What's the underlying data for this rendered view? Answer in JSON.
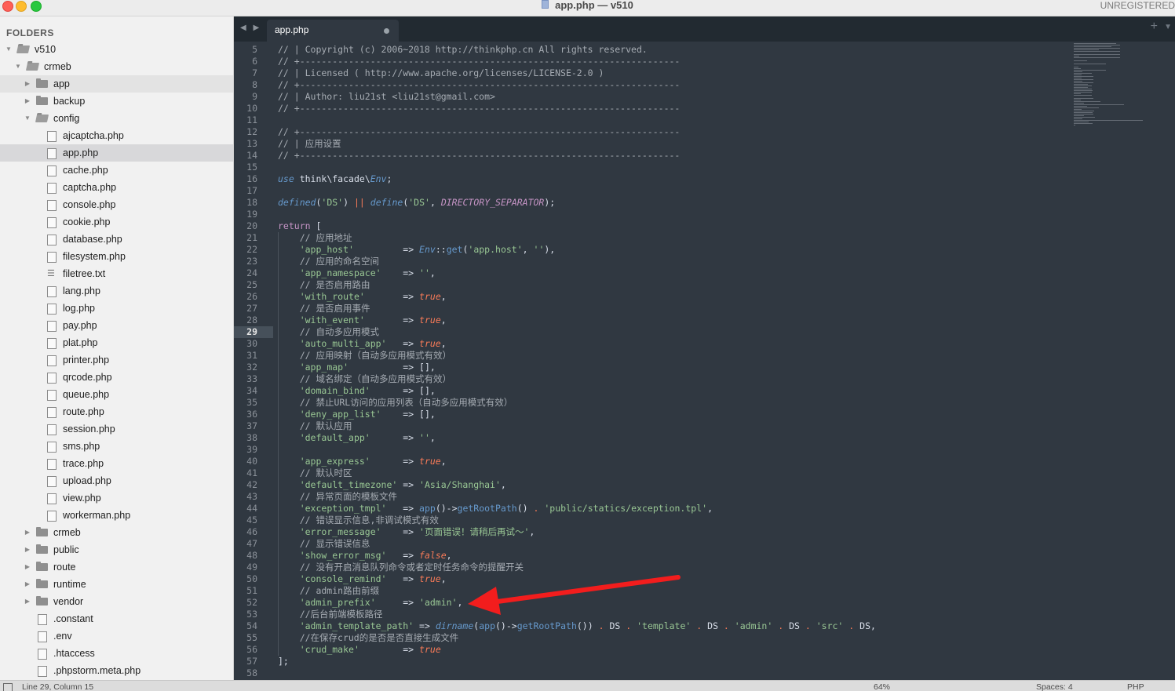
{
  "window": {
    "title": "app.php — v510",
    "license": "UNREGISTERED"
  },
  "sidebar": {
    "header": "FOLDERS",
    "items": [
      {
        "label": "v510",
        "kind": "folder",
        "open": true,
        "depth": 0
      },
      {
        "label": "crmeb",
        "kind": "folder",
        "open": true,
        "depth": 1
      },
      {
        "label": "app",
        "kind": "folder",
        "open": false,
        "depth": 2
      },
      {
        "label": "backup",
        "kind": "folder",
        "open": false,
        "depth": 2
      },
      {
        "label": "config",
        "kind": "folder",
        "open": true,
        "depth": 2
      },
      {
        "label": "ajcaptcha.php",
        "kind": "file",
        "depth": 3
      },
      {
        "label": "app.php",
        "kind": "file",
        "depth": 3,
        "selected": true
      },
      {
        "label": "cache.php",
        "kind": "file",
        "depth": 3
      },
      {
        "label": "captcha.php",
        "kind": "file",
        "depth": 3
      },
      {
        "label": "console.php",
        "kind": "file",
        "depth": 3
      },
      {
        "label": "cookie.php",
        "kind": "file",
        "depth": 3
      },
      {
        "label": "database.php",
        "kind": "file",
        "depth": 3
      },
      {
        "label": "filesystem.php",
        "kind": "file",
        "depth": 3
      },
      {
        "label": "filetree.txt",
        "kind": "txt",
        "depth": 3
      },
      {
        "label": "lang.php",
        "kind": "file",
        "depth": 3
      },
      {
        "label": "log.php",
        "kind": "file",
        "depth": 3
      },
      {
        "label": "pay.php",
        "kind": "file",
        "depth": 3
      },
      {
        "label": "plat.php",
        "kind": "file",
        "depth": 3
      },
      {
        "label": "printer.php",
        "kind": "file",
        "depth": 3
      },
      {
        "label": "qrcode.php",
        "kind": "file",
        "depth": 3
      },
      {
        "label": "queue.php",
        "kind": "file",
        "depth": 3
      },
      {
        "label": "route.php",
        "kind": "file",
        "depth": 3
      },
      {
        "label": "session.php",
        "kind": "file",
        "depth": 3
      },
      {
        "label": "sms.php",
        "kind": "file",
        "depth": 3
      },
      {
        "label": "trace.php",
        "kind": "file",
        "depth": 3
      },
      {
        "label": "upload.php",
        "kind": "file",
        "depth": 3
      },
      {
        "label": "view.php",
        "kind": "file",
        "depth": 3
      },
      {
        "label": "workerman.php",
        "kind": "file",
        "depth": 3
      },
      {
        "label": "crmeb",
        "kind": "folder",
        "open": false,
        "depth": 2
      },
      {
        "label": "public",
        "kind": "folder",
        "open": false,
        "depth": 2
      },
      {
        "label": "route",
        "kind": "folder",
        "open": false,
        "depth": 2
      },
      {
        "label": "runtime",
        "kind": "folder",
        "open": false,
        "depth": 2
      },
      {
        "label": "vendor",
        "kind": "folder",
        "open": false,
        "depth": 2
      },
      {
        "label": ".constant",
        "kind": "file",
        "depth": 2
      },
      {
        "label": ".env",
        "kind": "file",
        "depth": 2
      },
      {
        "label": ".htaccess",
        "kind": "file",
        "depth": 2
      },
      {
        "label": ".phpstorm.meta.php",
        "kind": "file",
        "depth": 2
      }
    ]
  },
  "tabs": {
    "nav": "◀ ▶",
    "active_label": "app.php",
    "new_tab": "+",
    "menu": "▼"
  },
  "editor": {
    "current_line": 29,
    "lines": [
      {
        "n": "5",
        "t": [
          [
            "c-com",
            "// | Copyright (c) 2006~2018 http://thinkphp.cn All rights reserved."
          ]
        ]
      },
      {
        "n": "6",
        "t": [
          [
            "c-com",
            "// +----------------------------------------------------------------------"
          ]
        ]
      },
      {
        "n": "7",
        "t": [
          [
            "c-com",
            "// | Licensed ( http://www.apache.org/licenses/LICENSE-2.0 )"
          ]
        ]
      },
      {
        "n": "8",
        "t": [
          [
            "c-com",
            "// +----------------------------------------------------------------------"
          ]
        ]
      },
      {
        "n": "9",
        "t": [
          [
            "c-com",
            "// | Author: liu21st <liu21st@gmail.com>"
          ]
        ]
      },
      {
        "n": "10",
        "t": [
          [
            "c-com",
            "// +----------------------------------------------------------------------"
          ]
        ]
      },
      {
        "n": "11",
        "t": []
      },
      {
        "n": "12",
        "t": [
          [
            "c-com",
            "// +----------------------------------------------------------------------"
          ]
        ]
      },
      {
        "n": "13",
        "t": [
          [
            "c-com",
            "// | 应用设置"
          ]
        ]
      },
      {
        "n": "14",
        "t": [
          [
            "c-com",
            "// +----------------------------------------------------------------------"
          ]
        ]
      },
      {
        "n": "15",
        "t": []
      },
      {
        "n": "16",
        "t": [
          [
            "c-fn",
            "use"
          ],
          [
            "c-plain",
            " think\\facade\\"
          ],
          [
            "c-fn",
            "Env"
          ],
          [
            "c-plain",
            ";"
          ]
        ]
      },
      {
        "n": "17",
        "t": []
      },
      {
        "n": "18",
        "t": [
          [
            "c-fn",
            "defined"
          ],
          [
            "c-plain",
            "("
          ],
          [
            "c-str",
            "'DS'"
          ],
          [
            "c-plain",
            ") "
          ],
          [
            "c-op",
            "||"
          ],
          [
            "c-plain",
            " "
          ],
          [
            "c-fn",
            "define"
          ],
          [
            "c-plain",
            "("
          ],
          [
            "c-str",
            "'DS'"
          ],
          [
            "c-plain",
            ", "
          ],
          [
            "c-const",
            "DIRECTORY_SEPARATOR"
          ],
          [
            "c-plain",
            ");"
          ]
        ]
      },
      {
        "n": "19",
        "t": []
      },
      {
        "n": "20",
        "t": [
          [
            "c-kw",
            "return"
          ],
          [
            "c-plain",
            " ["
          ]
        ]
      },
      {
        "n": "21",
        "t": [
          [
            "c-com",
            "    // 应用地址"
          ]
        ]
      },
      {
        "n": "22",
        "t": [
          [
            "c-plain",
            "    "
          ],
          [
            "c-str",
            "'app_host'"
          ],
          [
            "c-plain",
            "         => "
          ],
          [
            "c-fn",
            "Env"
          ],
          [
            "c-plain",
            "::"
          ],
          [
            "c-fn2",
            "get"
          ],
          [
            "c-plain",
            "("
          ],
          [
            "c-str",
            "'app.host'"
          ],
          [
            "c-plain",
            ", "
          ],
          [
            "c-str",
            "''"
          ],
          [
            "c-plain",
            "),"
          ]
        ]
      },
      {
        "n": "23",
        "t": [
          [
            "c-com",
            "    // 应用的命名空间"
          ]
        ]
      },
      {
        "n": "24",
        "t": [
          [
            "c-plain",
            "    "
          ],
          [
            "c-str",
            "'app_namespace'"
          ],
          [
            "c-plain",
            "    => "
          ],
          [
            "c-str",
            "''"
          ],
          [
            "c-plain",
            ","
          ]
        ]
      },
      {
        "n": "25",
        "t": [
          [
            "c-com",
            "    // 是否启用路由"
          ]
        ]
      },
      {
        "n": "26",
        "t": [
          [
            "c-plain",
            "    "
          ],
          [
            "c-str",
            "'with_route'"
          ],
          [
            "c-plain",
            "       => "
          ],
          [
            "c-bool",
            "true"
          ],
          [
            "c-plain",
            ","
          ]
        ]
      },
      {
        "n": "27",
        "t": [
          [
            "c-com",
            "    // 是否启用事件"
          ]
        ]
      },
      {
        "n": "28",
        "t": [
          [
            "c-plain",
            "    "
          ],
          [
            "c-str",
            "'with_event'"
          ],
          [
            "c-plain",
            "       => "
          ],
          [
            "c-bool",
            "true"
          ],
          [
            "c-plain",
            ","
          ]
        ]
      },
      {
        "n": "29",
        "t": [
          [
            "c-com",
            "    // 自动多应用模式"
          ]
        ]
      },
      {
        "n": "30",
        "t": [
          [
            "c-plain",
            "    "
          ],
          [
            "c-str",
            "'auto_multi_app'"
          ],
          [
            "c-plain",
            "   => "
          ],
          [
            "c-bool",
            "true"
          ],
          [
            "c-plain",
            ","
          ]
        ]
      },
      {
        "n": "31",
        "t": [
          [
            "c-com",
            "    // 应用映射（自动多应用模式有效）"
          ]
        ]
      },
      {
        "n": "32",
        "t": [
          [
            "c-plain",
            "    "
          ],
          [
            "c-str",
            "'app_map'"
          ],
          [
            "c-plain",
            "          => [],"
          ]
        ]
      },
      {
        "n": "33",
        "t": [
          [
            "c-com",
            "    // 域名绑定（自动多应用模式有效）"
          ]
        ]
      },
      {
        "n": "34",
        "t": [
          [
            "c-plain",
            "    "
          ],
          [
            "c-str",
            "'domain_bind'"
          ],
          [
            "c-plain",
            "      => [],"
          ]
        ]
      },
      {
        "n": "35",
        "t": [
          [
            "c-com",
            "    // 禁止URL访问的应用列表（自动多应用模式有效）"
          ]
        ]
      },
      {
        "n": "36",
        "t": [
          [
            "c-plain",
            "    "
          ],
          [
            "c-str",
            "'deny_app_list'"
          ],
          [
            "c-plain",
            "    => [],"
          ]
        ]
      },
      {
        "n": "37",
        "t": [
          [
            "c-com",
            "    // 默认应用"
          ]
        ]
      },
      {
        "n": "38",
        "t": [
          [
            "c-plain",
            "    "
          ],
          [
            "c-str",
            "'default_app'"
          ],
          [
            "c-plain",
            "      => "
          ],
          [
            "c-str",
            "''"
          ],
          [
            "c-plain",
            ","
          ]
        ]
      },
      {
        "n": "39",
        "t": []
      },
      {
        "n": "40",
        "t": [
          [
            "c-plain",
            "    "
          ],
          [
            "c-str",
            "'app_express'"
          ],
          [
            "c-plain",
            "      => "
          ],
          [
            "c-bool",
            "true"
          ],
          [
            "c-plain",
            ","
          ]
        ]
      },
      {
        "n": "41",
        "t": [
          [
            "c-com",
            "    // 默认时区"
          ]
        ]
      },
      {
        "n": "42",
        "t": [
          [
            "c-plain",
            "    "
          ],
          [
            "c-str",
            "'default_timezone'"
          ],
          [
            "c-plain",
            " => "
          ],
          [
            "c-str",
            "'Asia/Shanghai'"
          ],
          [
            "c-plain",
            ","
          ]
        ]
      },
      {
        "n": "43",
        "t": [
          [
            "c-com",
            "    // 异常页面的模板文件"
          ]
        ]
      },
      {
        "n": "44",
        "t": [
          [
            "c-plain",
            "    "
          ],
          [
            "c-str",
            "'exception_tmpl'"
          ],
          [
            "c-plain",
            "   => "
          ],
          [
            "c-fn2",
            "app"
          ],
          [
            "c-plain",
            "()->"
          ],
          [
            "c-fn2",
            "getRootPath"
          ],
          [
            "c-plain",
            "() "
          ],
          [
            "c-op",
            "."
          ],
          [
            "c-plain",
            " "
          ],
          [
            "c-str",
            "'public/statics/exception.tpl'"
          ],
          [
            "c-plain",
            ","
          ]
        ]
      },
      {
        "n": "45",
        "t": [
          [
            "c-com",
            "    // 错误显示信息,非调试模式有效"
          ]
        ]
      },
      {
        "n": "46",
        "t": [
          [
            "c-plain",
            "    "
          ],
          [
            "c-str",
            "'error_message'"
          ],
          [
            "c-plain",
            "    => "
          ],
          [
            "c-str",
            "'页面错误！请稍后再试～'"
          ],
          [
            "c-plain",
            ","
          ]
        ]
      },
      {
        "n": "47",
        "t": [
          [
            "c-com",
            "    // 显示错误信息"
          ]
        ]
      },
      {
        "n": "48",
        "t": [
          [
            "c-plain",
            "    "
          ],
          [
            "c-str",
            "'show_error_msg'"
          ],
          [
            "c-plain",
            "   => "
          ],
          [
            "c-bool",
            "false"
          ],
          [
            "c-plain",
            ","
          ]
        ]
      },
      {
        "n": "49",
        "t": [
          [
            "c-com",
            "    // 没有开启消息队列命令或者定时任务命令的提醒开关"
          ]
        ]
      },
      {
        "n": "50",
        "t": [
          [
            "c-plain",
            "    "
          ],
          [
            "c-str",
            "'console_remind'"
          ],
          [
            "c-plain",
            "   => "
          ],
          [
            "c-bool",
            "true"
          ],
          [
            "c-plain",
            ","
          ]
        ]
      },
      {
        "n": "51",
        "t": [
          [
            "c-com",
            "    // admin路由前缀"
          ]
        ]
      },
      {
        "n": "52",
        "t": [
          [
            "c-plain",
            "    "
          ],
          [
            "c-str",
            "'admin_prefix'"
          ],
          [
            "c-plain",
            "     => "
          ],
          [
            "c-str",
            "'admin'"
          ],
          [
            "c-plain",
            ","
          ]
        ]
      },
      {
        "n": "53",
        "t": [
          [
            "c-com",
            "    //后台前端模板路径"
          ]
        ]
      },
      {
        "n": "54",
        "t": [
          [
            "c-plain",
            "    "
          ],
          [
            "c-str",
            "'admin_template_path'"
          ],
          [
            "c-plain",
            " => "
          ],
          [
            "c-fn",
            "dirname"
          ],
          [
            "c-plain",
            "("
          ],
          [
            "c-fn2",
            "app"
          ],
          [
            "c-plain",
            "()->"
          ],
          [
            "c-fn2",
            "getRootPath"
          ],
          [
            "c-plain",
            "()) "
          ],
          [
            "c-op",
            "."
          ],
          [
            "c-plain",
            " DS "
          ],
          [
            "c-op",
            "."
          ],
          [
            "c-plain",
            " "
          ],
          [
            "c-str",
            "'template'"
          ],
          [
            "c-plain",
            " "
          ],
          [
            "c-op",
            "."
          ],
          [
            "c-plain",
            " DS "
          ],
          [
            "c-op",
            "."
          ],
          [
            "c-plain",
            " "
          ],
          [
            "c-str",
            "'admin'"
          ],
          [
            "c-plain",
            " "
          ],
          [
            "c-op",
            "."
          ],
          [
            "c-plain",
            " DS "
          ],
          [
            "c-op",
            "."
          ],
          [
            "c-plain",
            " "
          ],
          [
            "c-str",
            "'src'"
          ],
          [
            "c-plain",
            " "
          ],
          [
            "c-op",
            "."
          ],
          [
            "c-plain",
            " DS,"
          ]
        ]
      },
      {
        "n": "55",
        "t": [
          [
            "c-com",
            "    //在保存crud的是否是否直接生成文件"
          ]
        ]
      },
      {
        "n": "56",
        "t": [
          [
            "c-plain",
            "    "
          ],
          [
            "c-str",
            "'crud_make'"
          ],
          [
            "c-plain",
            "        => "
          ],
          [
            "c-bool",
            "true"
          ]
        ]
      },
      {
        "n": "57",
        "t": [
          [
            "c-plain",
            "];"
          ]
        ]
      },
      {
        "n": "58",
        "t": []
      }
    ]
  },
  "statusbar": {
    "position": "Line 29, Column 15",
    "zoom": "64%",
    "spaces": "Spaces: 4",
    "syntax": "PHP"
  },
  "colors": {
    "editor_bg": "#303841",
    "annotation_arrow": "#f21d1d"
  }
}
